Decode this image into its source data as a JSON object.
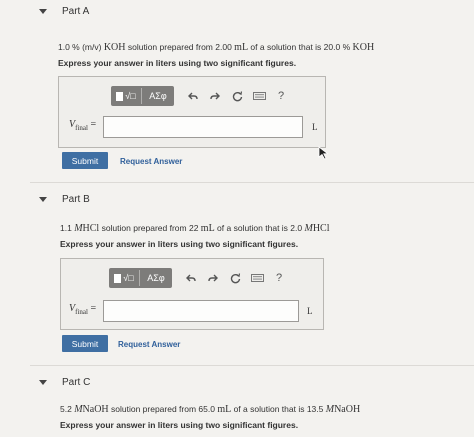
{
  "parts": [
    {
      "title": "Part A",
      "question": {
        "prefix": "1.0 % (m/v) ",
        "solute": "KOH",
        "mid1": " solution prepared from 2.00 ",
        "unit1": "mL",
        "mid2": " of a solution that is 20.0 % ",
        "solute2": "KOH"
      },
      "instruction": "Express your answer in liters using two significant figures.",
      "variable": "V",
      "variable_sub": "final",
      "equals": "=",
      "unit": "L",
      "submit_label": "Submit",
      "request_label": "Request Answer"
    },
    {
      "title": "Part B",
      "question": {
        "prefix": "1.1 ",
        "conc": "M",
        "solute": "HCl",
        "mid1": " solution prepared from 22 ",
        "unit1": "mL",
        "mid2": " of a solution that is 2.0 ",
        "conc2": "M",
        "solute2": "HCl"
      },
      "instruction": "Express your answer in liters using two significant figures.",
      "variable": "V",
      "variable_sub": "final",
      "equals": "=",
      "unit": "L",
      "submit_label": "Submit",
      "request_label": "Request Answer"
    },
    {
      "title": "Part C",
      "question": {
        "prefix": "5.2 ",
        "conc": "M",
        "solute": "NaOH",
        "mid1": " solution prepared from 65.0 ",
        "unit1": "mL",
        "mid2": " of a solution that is 13.5 ",
        "conc2": "M",
        "solute2": "NaOH"
      },
      "instruction": "Express your answer in liters using two significant figures."
    }
  ],
  "toolbar": {
    "template_glyph": "√□",
    "greek_label": "ΑΣφ",
    "undo_icon": "undo-icon",
    "redo_icon": "redo-icon",
    "reset_icon": "reset-icon",
    "keyboard_icon": "keyboard-icon",
    "help_label": "?"
  },
  "colors": {
    "background": "#f3f2ef",
    "submit": "#3f6fa3",
    "link": "#2f5f9a",
    "toolbar": "#7d7c7a"
  }
}
